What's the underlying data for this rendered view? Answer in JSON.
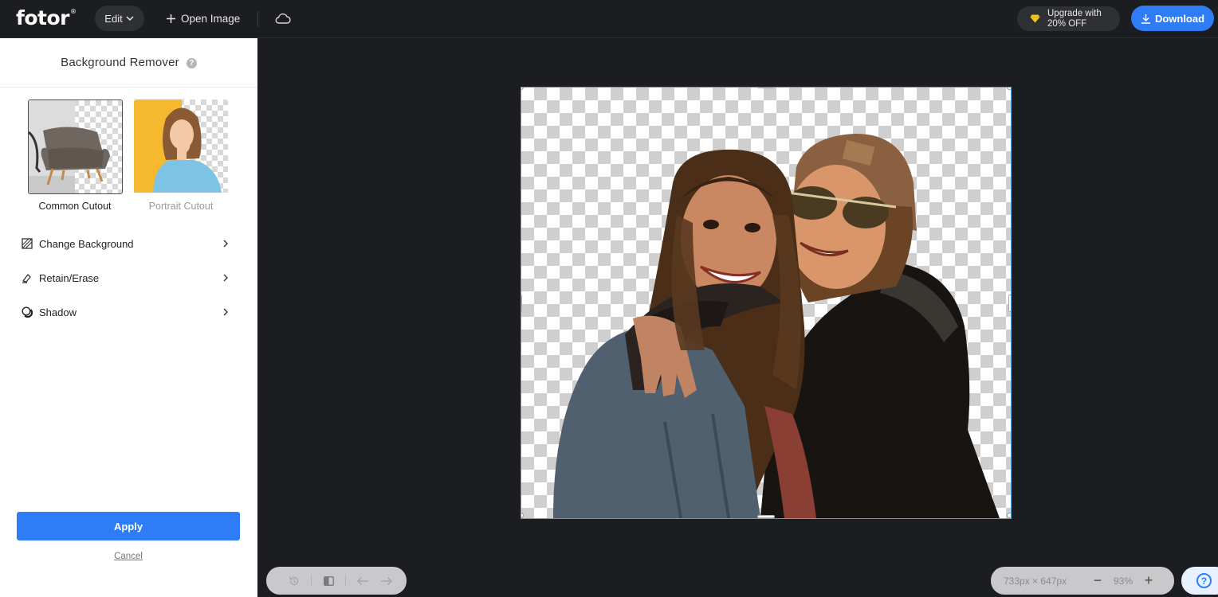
{
  "header": {
    "logo": "fotor",
    "logo_mark": "®",
    "edit_label": "Edit",
    "open_image_label": "Open Image",
    "upgrade_line1": "Upgrade with",
    "upgrade_line2": "20% OFF",
    "download_label": "Download"
  },
  "panel": {
    "title": "Background Remover",
    "help_glyph": "?",
    "cutouts": [
      {
        "label": "Common Cutout",
        "selected": true
      },
      {
        "label": "Portrait Cutout",
        "selected": false
      }
    ],
    "menu": [
      {
        "label": "Change Background",
        "icon": "pattern-square-icon"
      },
      {
        "label": "Retain/Erase",
        "icon": "eraser-icon"
      },
      {
        "label": "Shadow",
        "icon": "shadow-icon"
      }
    ],
    "apply_label": "Apply",
    "cancel_label": "Cancel"
  },
  "canvas": {
    "image": "two smiling women hugging, background removed"
  },
  "zoom": {
    "size": "733px × 647px",
    "minus": "−",
    "plus": "+",
    "percent": "93%"
  },
  "help_fab_glyph": "?",
  "colors": {
    "accent": "#2f7df6",
    "dark_bg": "#1c1d20",
    "selection": "#4aa3df"
  }
}
